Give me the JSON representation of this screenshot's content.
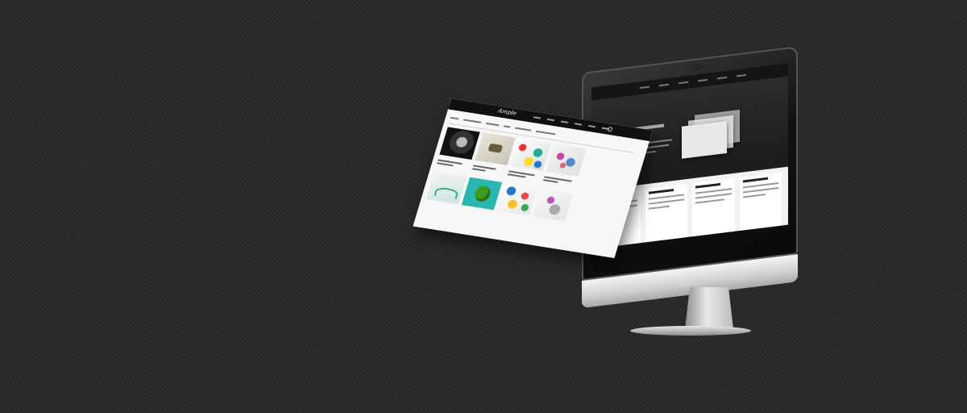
{
  "scene": {
    "background_color": "#2b2b2b",
    "accent_screen_color": "#1e1e1e",
    "page_background_color": "#f7f7f7"
  },
  "floating_page": {
    "logo_text": "Ample"
  },
  "icons": {
    "search": "search-icon"
  }
}
